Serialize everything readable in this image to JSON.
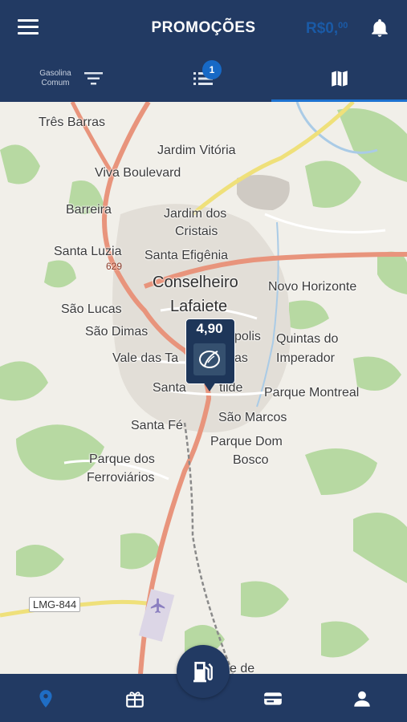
{
  "header": {
    "title": "PROMOÇÕES",
    "balance_main": "R$0,",
    "balance_cents": "00",
    "icons": {
      "menu": "hamburger-icon",
      "notifications": "bell-icon"
    },
    "balance_color": "#1a5aa6"
  },
  "subbar": {
    "fuel_type_line1": "Gasolina",
    "fuel_type_line2": "Comum",
    "list_badge": "1",
    "active_tab": "map",
    "icons": {
      "filter": "filter-icon",
      "list": "list-icon",
      "map": "map-icon"
    }
  },
  "map": {
    "places": {
      "tres_barras": "Três Barras",
      "jardim_vitoria": "Jardim Vitória",
      "viva_boulevard": "Viva Boulevard",
      "barreira": "Barreira",
      "jardim_dos_1": "Jardim dos",
      "jardim_dos_2": "Cristais",
      "santa_luzia": "Santa Luzia",
      "santa_efigenia": "Santa Efigênia",
      "conselheiro": "Conselheiro",
      "lafaiete": "Lafaiete",
      "novo_horizonte": "Novo Horizonte",
      "sao_lucas": "São Lucas",
      "sao_dimas": "São Dimas",
      "polis": "polis",
      "quintas_1": "Quintas do",
      "quintas_2": "Imperador",
      "vale_das": "Vale das Ta",
      "vale_das_end": "as",
      "santa_matilde_a": "Santa ",
      "santa_matilde_b": "tilde",
      "parque_montreal": "Parque Montreal",
      "sao_marcos": "São Marcos",
      "santa_fe": "Santa Fé",
      "parque_dom_1": "Parque Dom",
      "parque_dom_2": "Bosco",
      "parque_dos_1": "Parque dos",
      "parque_dos_2": "Ferroviários",
      "bottom_partial": "e de"
    },
    "road_629": "629",
    "road_lmg": "LMG-844",
    "marker_price": "4,90"
  },
  "bottom_nav": {
    "items": [
      "location-pin-icon",
      "gift-icon",
      "fuel-pump-icon",
      "card-icon",
      "user-icon"
    ],
    "active": "location-pin-icon",
    "active_color": "#1f6dc4"
  }
}
